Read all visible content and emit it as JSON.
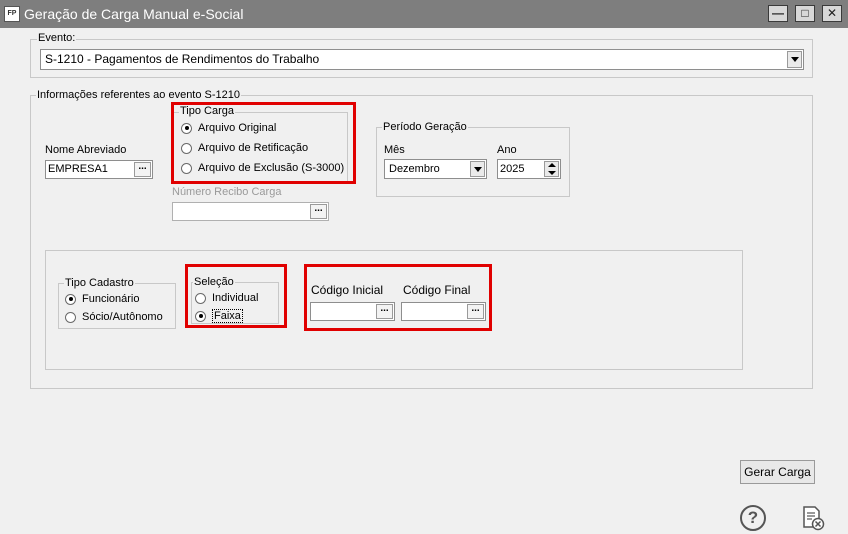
{
  "window": {
    "app_icon": "FP",
    "title": "Geração de Carga Manual e-Social"
  },
  "evento": {
    "label": "Evento:",
    "value": "S-1210 - Pagamentos de Rendimentos do Trabalho"
  },
  "info": {
    "label": "Informações referentes ao evento S-1210"
  },
  "nome_abreviado": {
    "label": "Nome Abreviado",
    "value": "EMPRESA1",
    "button": "..."
  },
  "tipo_carga": {
    "label": "Tipo Carga",
    "options": [
      {
        "label": "Arquivo Original",
        "selected": true
      },
      {
        "label": "Arquivo de Retificação",
        "selected": false
      },
      {
        "label": "Arquivo de Exclusão (S-3000)",
        "selected": false
      }
    ]
  },
  "numero_recibo": {
    "label": "Número Recibo Carga",
    "value": "",
    "button": "..."
  },
  "periodo": {
    "label": "Período Geração",
    "mes_label": "Mês",
    "mes_value": "Dezembro",
    "ano_label": "Ano",
    "ano_value": "2025"
  },
  "tipo_cadastro": {
    "label": "Tipo Cadastro",
    "options": [
      {
        "label": "Funcionário",
        "selected": true
      },
      {
        "label": "Sócio/Autônomo",
        "selected": false
      }
    ]
  },
  "selecao": {
    "label": "Seleção",
    "options": [
      {
        "label": "Individual",
        "selected": false
      },
      {
        "label": "Faixa",
        "selected": true
      }
    ]
  },
  "codigo_inicial": {
    "label": "Código Inicial",
    "value": "",
    "button": "..."
  },
  "codigo_final": {
    "label": "Código Final",
    "value": "",
    "button": "..."
  },
  "gerar_button": "Gerar Carga",
  "help_icon_text": "?",
  "colors": {
    "titlebar": "#7e7e7e",
    "highlight": "#e00000",
    "background": "#f0f0f0"
  }
}
